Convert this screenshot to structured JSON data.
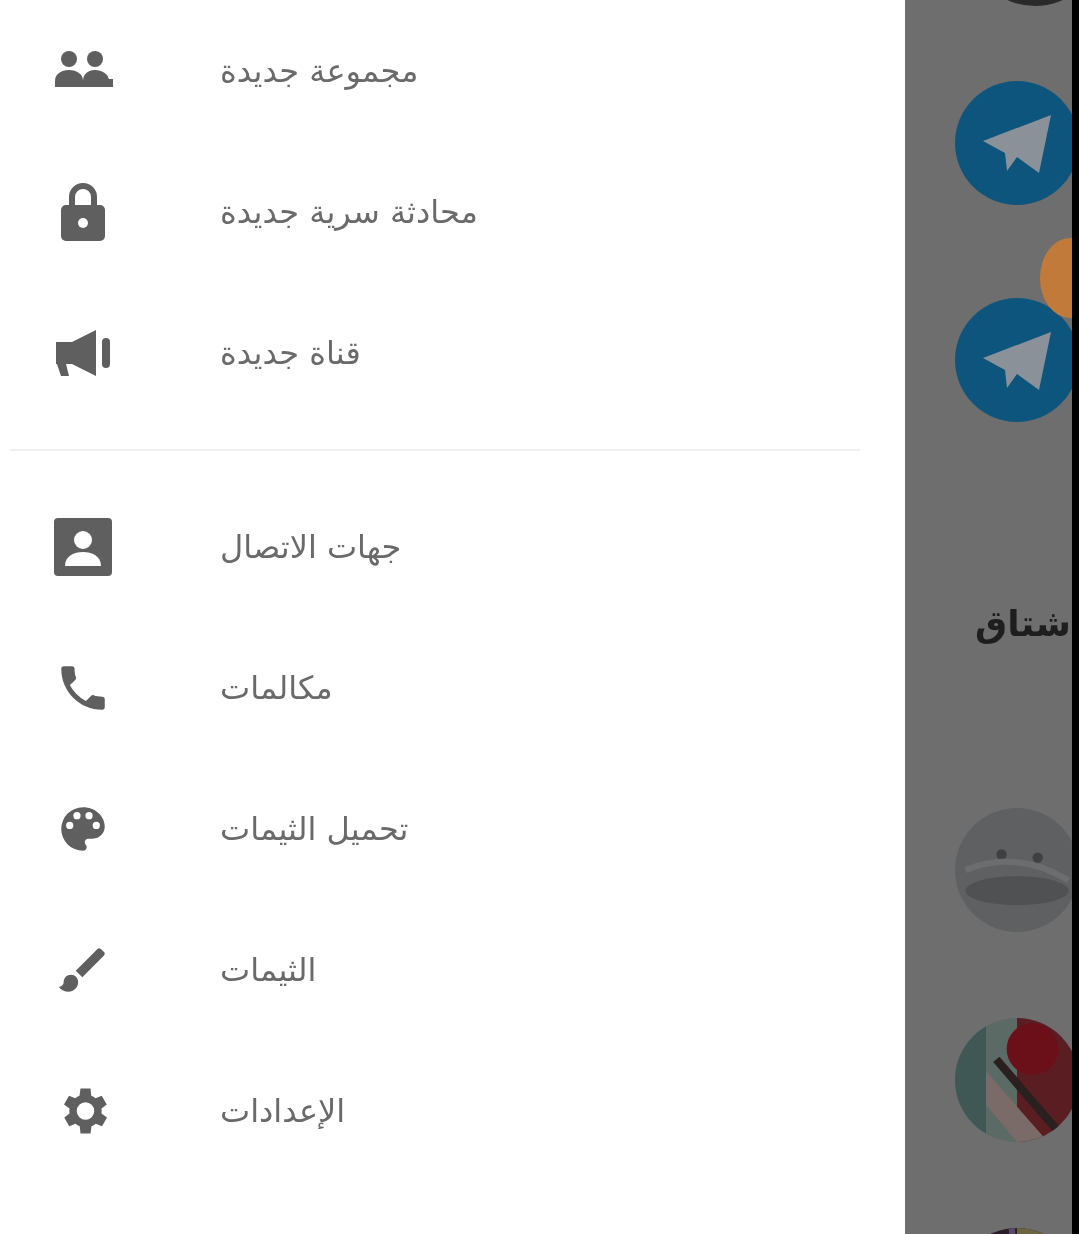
{
  "menu": {
    "sections": [
      {
        "items": [
          {
            "kind": "group",
            "label": "مجموعة جديدة"
          },
          {
            "kind": "lock",
            "label": "محادثة سرية جديدة"
          },
          {
            "kind": "megaphone",
            "label": "قناة جديدة"
          }
        ]
      },
      {
        "items": [
          {
            "kind": "contacts",
            "label": "جهات الاتصال"
          },
          {
            "kind": "phone",
            "label": "مكالمات"
          },
          {
            "kind": "palette",
            "label": "تحميل الثيمات"
          },
          {
            "kind": "brush",
            "label": "الثيمات"
          },
          {
            "kind": "settings",
            "label": "الإعدادات"
          }
        ]
      }
    ]
  },
  "chat_list": {
    "items": [
      {
        "kind": "telegram"
      },
      {
        "kind": "telegram"
      },
      {
        "kind": "title",
        "title": "شتاق"
      },
      {
        "kind": "picture"
      },
      {
        "kind": "picture"
      },
      {
        "kind": "picture"
      }
    ]
  }
}
